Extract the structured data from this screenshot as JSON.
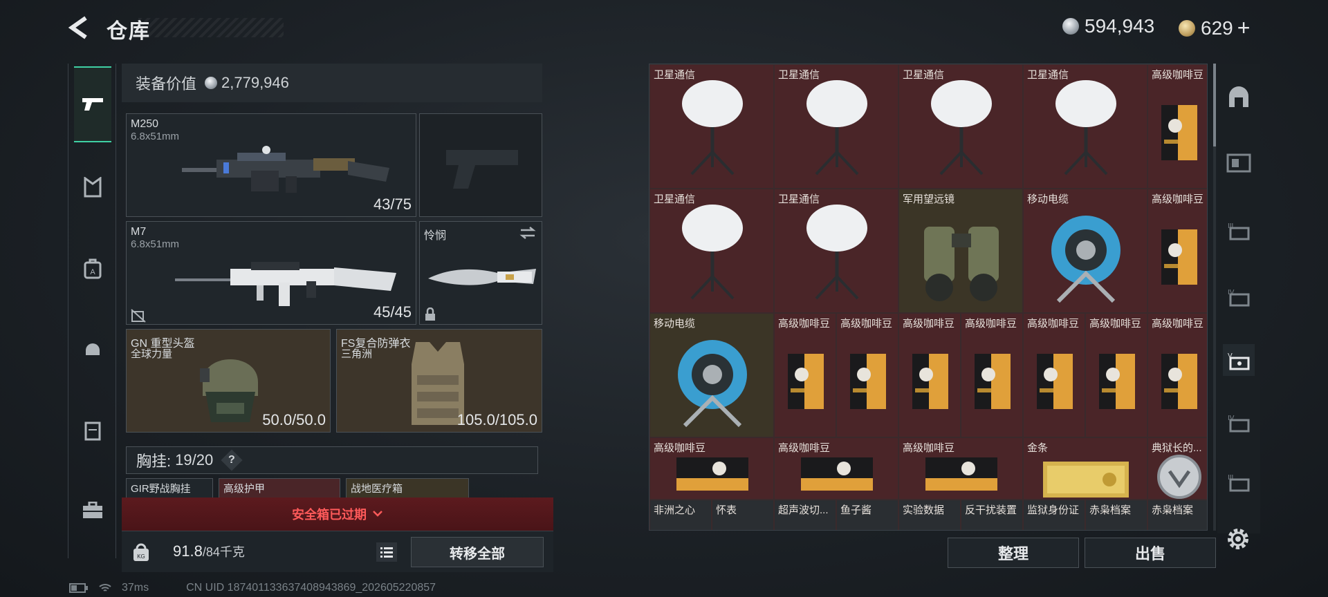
{
  "header": {
    "title": "仓库",
    "currency_silver": "594,943",
    "currency_gold": "629",
    "plus": "+"
  },
  "equipment": {
    "value_label": "装备价值",
    "value": "2,779,946",
    "primary_weapon": {
      "name": "M250",
      "caliber": "6.8x51mm",
      "ammo": "43/75"
    },
    "secondary_weapon": {
      "name": "M7",
      "caliber": "6.8x51mm",
      "ammo": "45/45"
    },
    "melee": {
      "name": "怜悯"
    },
    "helmet": {
      "name": "GN 重型头盔",
      "sub": "全球力量",
      "durability": "50.0/50.0"
    },
    "armor": {
      "name": "FS复合防弹衣",
      "sub": "三角洲",
      "durability": "105.0/105.0"
    },
    "chest_rig": {
      "label": "胸挂:",
      "capacity": "19/20",
      "help": "?"
    },
    "mini_slots": [
      "GIR野战胸挂",
      "高级护甲",
      "战地医疗箱"
    ],
    "safe_box": "安全箱已过期",
    "weight": "91.8",
    "weight_max": "/84千克",
    "transfer_all": "转移全部"
  },
  "inventory": {
    "cells": [
      {
        "label": "卫星通信",
        "item": "dish"
      },
      {
        "label": "卫星通信",
        "item": "dish"
      },
      {
        "label": "卫星通信",
        "item": "dish"
      },
      {
        "label": "卫星通信",
        "item": "dish"
      },
      {
        "label": "高级咖啡豆",
        "item": "coffee"
      },
      {
        "label": "卫星通信",
        "item": "dish"
      },
      {
        "label": "卫星通信",
        "item": "dish"
      },
      {
        "label": "军用望远镜",
        "item": "binoculars"
      },
      {
        "label": "移动电缆",
        "item": "reel"
      },
      {
        "label": "高级咖啡豆",
        "item": "coffee"
      },
      {
        "label": "移动电缆",
        "item": "reel"
      },
      {
        "label": "高级咖啡豆",
        "item": "coffee"
      },
      {
        "label": "高级咖啡豆",
        "item": "coffee"
      },
      {
        "label": "高级咖啡豆",
        "item": "coffee"
      },
      {
        "label": "高级咖啡豆",
        "item": "coffee"
      },
      {
        "label": "高级咖啡豆",
        "item": "coffee"
      },
      {
        "label": "高级咖啡豆",
        "item": "coffee"
      },
      {
        "label": "高级咖啡豆",
        "item": "coffee"
      },
      {
        "label": "高级咖啡豆",
        "item": "coffee-flat"
      },
      {
        "label": "高级咖啡豆",
        "item": "coffee-flat"
      },
      {
        "label": "高级咖啡豆",
        "item": "coffee-flat"
      },
      {
        "label": "金条",
        "item": "gold"
      },
      {
        "label": "典狱长的...",
        "item": "badge"
      },
      {
        "label": "非洲之心",
        "item": "none"
      },
      {
        "label": "怀表",
        "item": "none"
      },
      {
        "label": "超声波切...",
        "item": "none"
      },
      {
        "label": "鱼子酱",
        "item": "none"
      },
      {
        "label": "实验数据",
        "item": "none"
      },
      {
        "label": "反干扰装置",
        "item": "none"
      },
      {
        "label": "监狱身份证",
        "item": "none"
      },
      {
        "label": "赤枭档案",
        "item": "none"
      },
      {
        "label": "赤枭档案",
        "item": "none"
      }
    ],
    "sort_button": "整理",
    "sell_button": "出售"
  },
  "status": {
    "ping": "37ms",
    "uid": "CN UID 1874011336374089438​69_202605220857"
  },
  "colors": {
    "accent": "#3fd1a4",
    "danger": "#ff5a5a",
    "cell_red": "#4a2528",
    "cell_olive": "#3b3526"
  }
}
